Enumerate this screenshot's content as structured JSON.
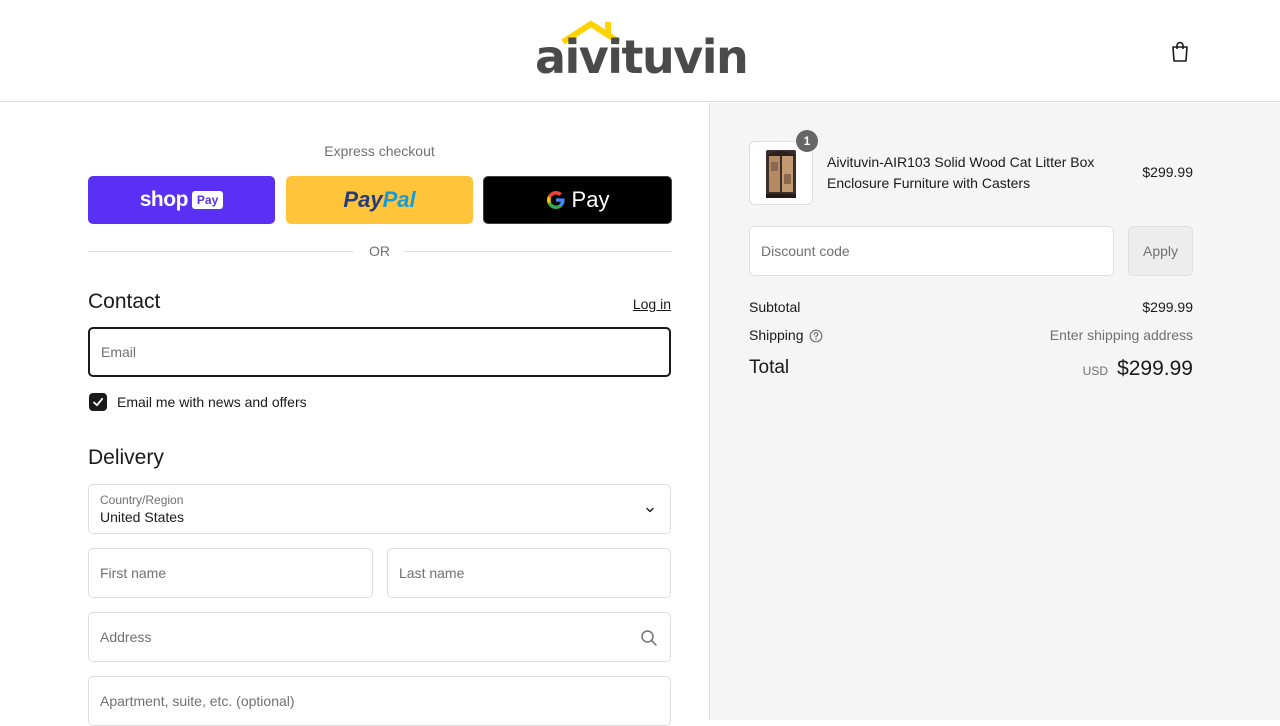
{
  "header": {
    "logo_text": "aivituvin",
    "cart_icon": "shopping-bag-icon"
  },
  "express": {
    "label": "Express checkout",
    "shop_pay": {
      "brand": "shop",
      "badge": "Pay",
      "color": "#5a31f4"
    },
    "paypal": {
      "part1": "Pay",
      "part2": "Pal",
      "color": "#ffc439"
    },
    "gpay": {
      "label": "Pay",
      "color": "#000000"
    },
    "or_text": "OR"
  },
  "contact": {
    "title": "Contact",
    "login_label": "Log in",
    "email_placeholder": "Email",
    "newsletter_label": "Email me with news and offers",
    "newsletter_checked": true
  },
  "delivery": {
    "title": "Delivery",
    "country_label": "Country/Region",
    "country_value": "United States",
    "first_name_placeholder": "First name",
    "last_name_placeholder": "Last name",
    "address_placeholder": "Address",
    "apartment_placeholder": "Apartment, suite, etc. (optional)"
  },
  "summary": {
    "product": {
      "name": "Aivituvin-AIR103 Solid Wood Cat Litter Box Enclosure Furniture with Casters",
      "price": "$299.99",
      "quantity": "1"
    },
    "discount_placeholder": "Discount code",
    "apply_label": "Apply",
    "subtotal_label": "Subtotal",
    "subtotal_value": "$299.99",
    "shipping_label": "Shipping",
    "shipping_value": "Enter shipping address",
    "total_label": "Total",
    "total_currency": "USD",
    "total_value": "$299.99"
  }
}
